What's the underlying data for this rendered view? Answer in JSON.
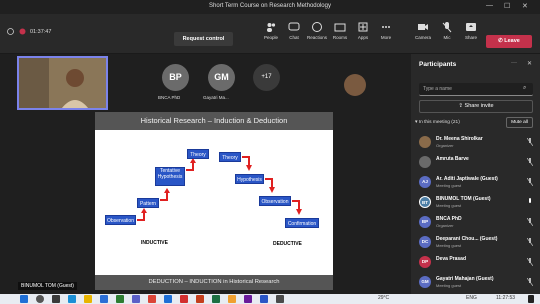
{
  "window": {
    "title": "Short Term Course on Research Methodology"
  },
  "toolbar": {
    "timer": "01:37:47",
    "request_control": "Request control",
    "items": [
      {
        "label": "People",
        "icon": "people-icon"
      },
      {
        "label": "Chat",
        "icon": "chat-icon"
      },
      {
        "label": "Reactions",
        "icon": "reactions-icon"
      },
      {
        "label": "Rooms",
        "icon": "rooms-icon"
      },
      {
        "label": "Apps",
        "icon": "apps-icon"
      },
      {
        "label": "More",
        "icon": "more-icon"
      },
      {
        "label": "Camera",
        "icon": "camera-icon"
      },
      {
        "label": "Mic",
        "icon": "mic-icon"
      },
      {
        "label": "Share",
        "icon": "share-icon"
      }
    ],
    "leave": "Leave"
  },
  "stage": {
    "tiles": [
      {
        "initials": "BP",
        "name": "BNCA PhD",
        "color": "#6b6b6b"
      },
      {
        "initials": "GM",
        "name": "Gayatri Ma...",
        "color": "#6b6b6b"
      }
    ],
    "overflow_count": "+17",
    "presenter_name": "BINUMOL TOM (Guest)"
  },
  "slide": {
    "title": "Historical Research – Induction & Deduction",
    "footer": "DEDUCTION – INDUCTION in Historical Research",
    "inductive": {
      "label": "INDUCTIVE",
      "steps": [
        "Observation",
        "Pattern",
        "Tentative Hypothesis",
        "Theory"
      ]
    },
    "deductive": {
      "label": "DEDUCTIVE",
      "steps": [
        "Theory",
        "Hypothesis",
        "Observation",
        "Confirmation"
      ]
    }
  },
  "panel": {
    "title": "Participants",
    "search_placeholder": "Type a name",
    "share_invite": "Share invite",
    "section": "In this meeting (21)",
    "mute_all": "Mute all",
    "people": [
      {
        "name": "Dr. Meena Shirolkar",
        "role": "Organizer",
        "initials": "",
        "color": "#8a6b4a"
      },
      {
        "name": "Amruta Barve",
        "role": "",
        "initials": "",
        "color": "#6a6a6a"
      },
      {
        "name": "Ar. Aditi Japtiwale (Guest)",
        "role": "Meeting guest",
        "initials": "AJ",
        "color": "#5b6cc2"
      },
      {
        "name": "BINUMOL TOM (Guest)",
        "role": "Meeting guest",
        "initials": "BT",
        "color": "#4d7fa6"
      },
      {
        "name": "BNCA PhD",
        "role": "Organizer",
        "initials": "BP",
        "color": "#5b6cc2"
      },
      {
        "name": "Deeparani Chou... (Guest)",
        "role": "Meeting guest",
        "initials": "DC",
        "color": "#5b6cc2"
      },
      {
        "name": "Deva Prasad",
        "role": "",
        "initials": "DP",
        "color": "#c4314b"
      },
      {
        "name": "Gayatri Mahajan (Guest)",
        "role": "Meeting guest",
        "initials": "GM",
        "color": "#5b6cc2"
      }
    ]
  },
  "taskbar": {
    "weather": "29°C",
    "time": "11:27:53",
    "lang": "ENG"
  }
}
